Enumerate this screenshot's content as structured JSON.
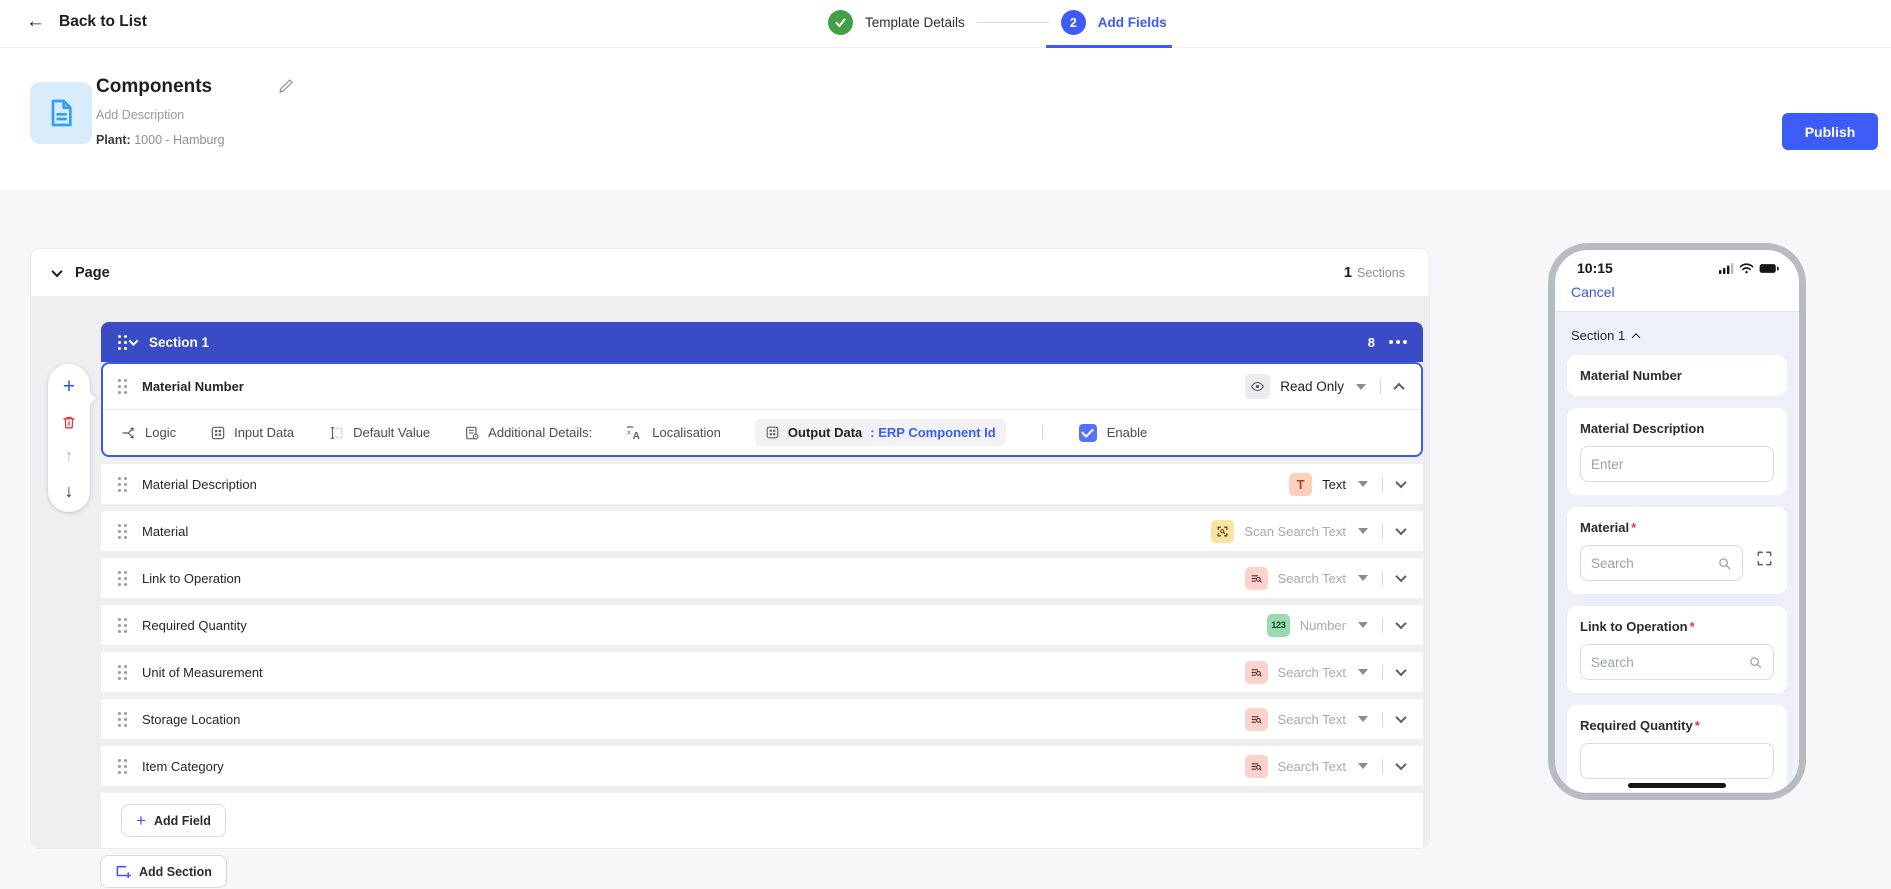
{
  "icons": {
    "back": "←",
    "plus": "+",
    "arrow_up": "↑",
    "arrow_down": "↓"
  },
  "topbar": {
    "back_label": "Back to List",
    "steps": [
      {
        "label": "Template Details",
        "state": "done"
      },
      {
        "number": "2",
        "label": "Add Fields",
        "state": "active"
      }
    ]
  },
  "header": {
    "title": "Components",
    "description": "Add Description",
    "plant_label": "Plant:",
    "plant_value": "1000 - Hamburg",
    "publish_label": "Publish"
  },
  "page": {
    "label": "Page",
    "sections_count": "1",
    "sections_word": "Sections"
  },
  "section": {
    "title": "Section 1",
    "field_count": "8"
  },
  "expanded_field": {
    "name": "Material Number",
    "mode": "Read Only",
    "tools": [
      {
        "label": "Logic"
      },
      {
        "label": "Input Data"
      },
      {
        "label": "Default Value"
      },
      {
        "label": "Additional Details:"
      },
      {
        "label": "Localisation"
      }
    ],
    "output_label": "Output Data",
    "output_value": ": ERP Component Id",
    "enable_label": "Enable"
  },
  "fields": [
    {
      "name": "Material Description",
      "chip": "T",
      "type": "Text",
      "muted": false
    },
    {
      "name": "Material",
      "chip": "scan",
      "type": "Scan Search Text",
      "muted": true
    },
    {
      "name": "Link to Operation",
      "chip": "search",
      "type": "Search Text",
      "muted": true
    },
    {
      "name": "Required Quantity",
      "chip": "123",
      "type": "Number",
      "muted": true
    },
    {
      "name": "Unit of Measurement",
      "chip": "search",
      "type": "Search Text",
      "muted": true
    },
    {
      "name": "Storage Location",
      "chip": "search",
      "type": "Search Text",
      "muted": true
    },
    {
      "name": "Item Category",
      "chip": "search",
      "type": "Search Text",
      "muted": true
    }
  ],
  "buttons": {
    "add_field": "Add Field",
    "add_section": "Add Section"
  },
  "phone": {
    "time": "10:15",
    "cancel_label": "Cancel",
    "section_label": "Section 1",
    "cards": [
      {
        "label": "Material Number"
      },
      {
        "label": "Material Description",
        "placeholder": "Enter"
      },
      {
        "label": "Material",
        "required": "*",
        "placeholder": "Search"
      },
      {
        "label": "Link to Operation",
        "required": "*",
        "placeholder": "Search"
      },
      {
        "label": "Required Quantity",
        "required": "*"
      }
    ]
  },
  "colors": {
    "primary": "#3d5bf5",
    "section_header": "#3a4bc6",
    "success": "#43a047",
    "danger": "#e2383f"
  }
}
